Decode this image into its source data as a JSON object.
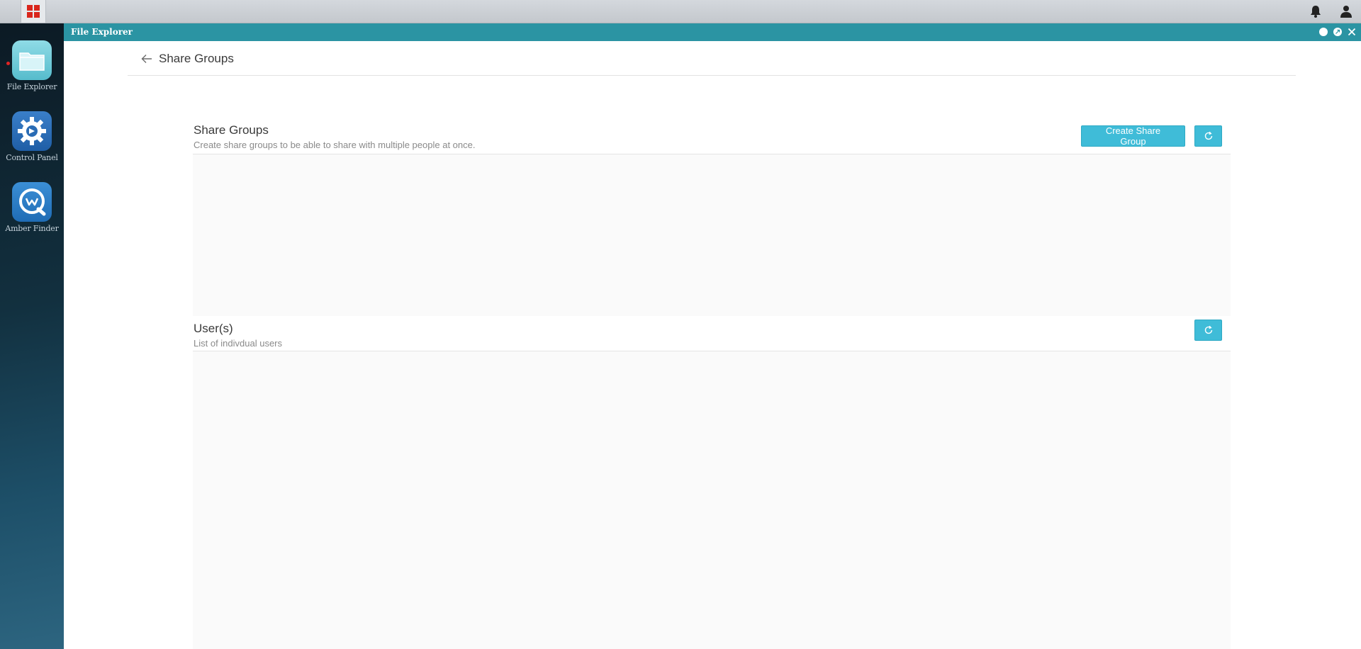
{
  "window": {
    "title": "File Explorer"
  },
  "dock": {
    "items": [
      {
        "label": "File Explorer",
        "icon": "folder-icon"
      },
      {
        "label": "Control Panel",
        "icon": "gear-icon"
      },
      {
        "label": "Amber Finder",
        "icon": "amber-finder-icon"
      }
    ]
  },
  "page": {
    "title": "Share Groups"
  },
  "share_groups": {
    "title": "Share Groups",
    "subtitle": "Create share groups to be able to share with multiple people at once.",
    "create_button": "Create Share Group",
    "rows": []
  },
  "users": {
    "title": "User(s)",
    "subtitle": "List of indivdual users",
    "rows": []
  },
  "colors": {
    "titlebar": "#2b94a3",
    "accent_button": "#3fbcd8",
    "start_red": "#d9261c"
  }
}
